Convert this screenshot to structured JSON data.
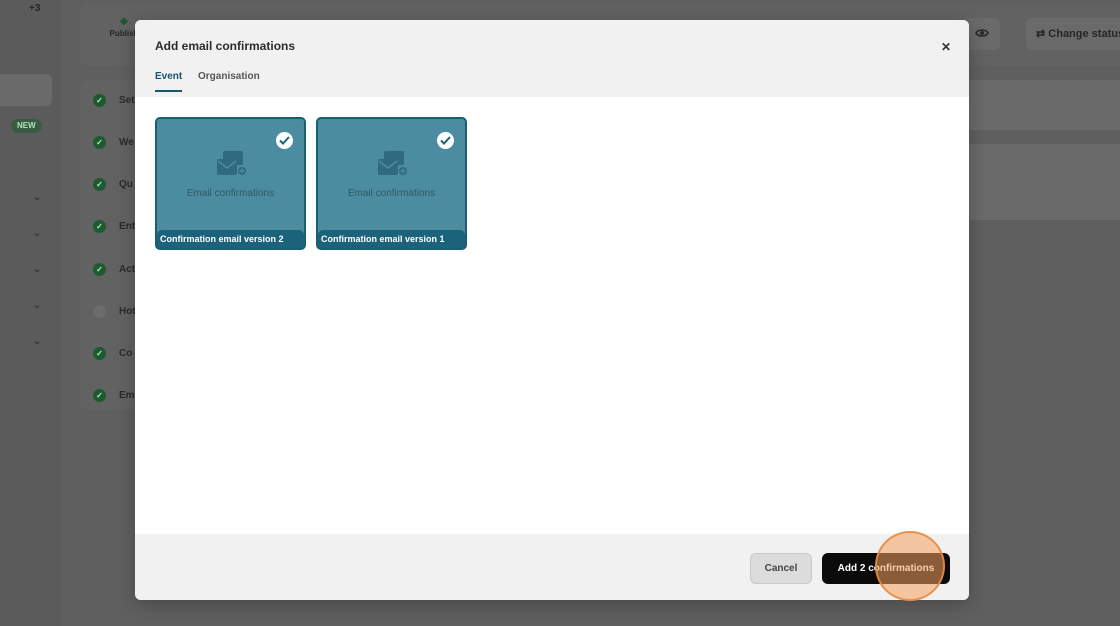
{
  "background": {
    "sidebar": {
      "counter": "+3",
      "new_badge": "NEW"
    },
    "topbar": {
      "publish_label": "Publish",
      "change_status_label": "Change status"
    },
    "checklist": [
      {
        "label": "Set",
        "done": true
      },
      {
        "label": "We",
        "done": true
      },
      {
        "label": "Qu",
        "done": true
      },
      {
        "label": "Ent",
        "done": true
      },
      {
        "label": "Act",
        "done": true
      },
      {
        "label": "Hot",
        "done": false
      },
      {
        "label": "Co",
        "done": true
      },
      {
        "label": "Em",
        "done": true
      }
    ]
  },
  "modal": {
    "title": "Add email confirmations",
    "close_icon": "close-icon",
    "tabs": [
      {
        "label": "Event",
        "active": true
      },
      {
        "label": "Organisation",
        "active": false
      }
    ],
    "templates": [
      {
        "thumb_caption": "Email confirmations",
        "name": "Confirmation email version 2",
        "selected": true,
        "icon": "email-templates-icon"
      },
      {
        "thumb_caption": "Email confirmations",
        "name": "Confirmation email version 1",
        "selected": true,
        "icon": "email-templates-icon"
      }
    ],
    "footer": {
      "cancel_label": "Cancel",
      "add_label": "Add 2 confirmations"
    }
  },
  "colors": {
    "accent": "#16556b",
    "card_fill": "#4b8ca0",
    "card_footer": "#1b627a",
    "primary_button": "#0b0b0b"
  }
}
